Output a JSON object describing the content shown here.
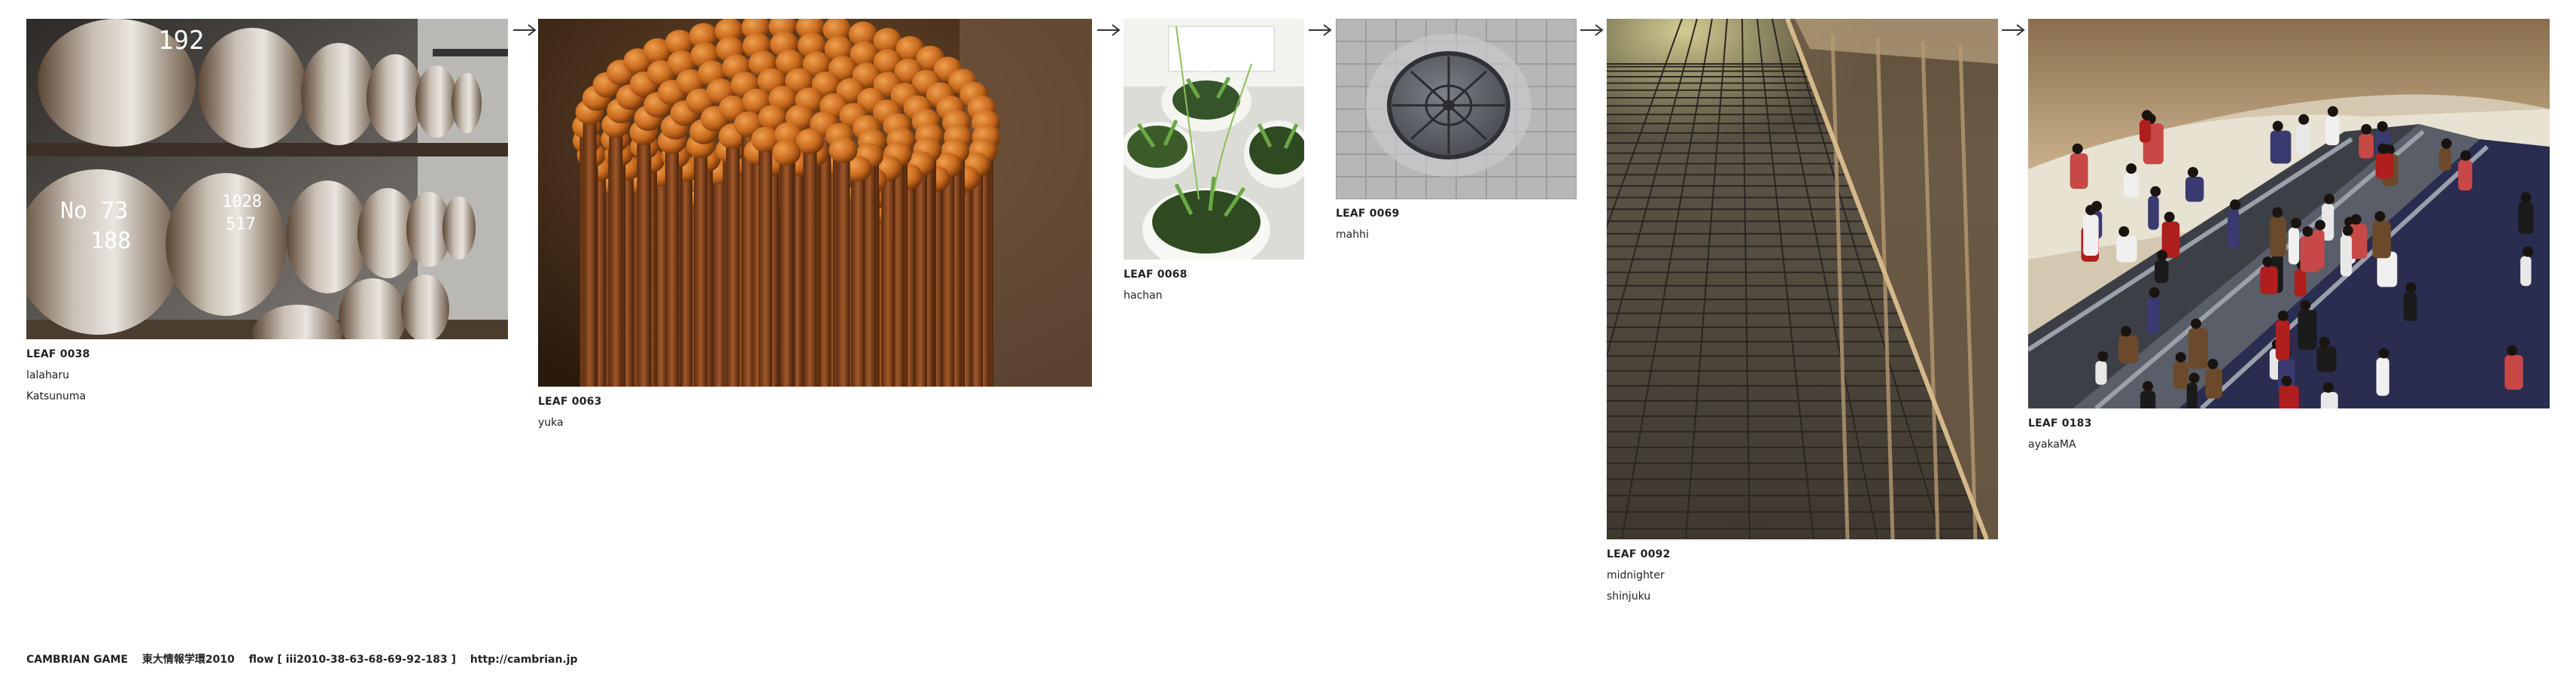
{
  "leaves": [
    {
      "id": "LEAF 0038",
      "lines": [
        "lalaharu",
        "Katsunuma"
      ],
      "subject": "whisky barrels in a warehouse"
    },
    {
      "id": "LEAF 0063",
      "lines": [
        "yuka"
      ],
      "subject": "bundle of matchsticks"
    },
    {
      "id": "LEAF 0068",
      "lines": [
        "hachan"
      ],
      "subject": "potted plants"
    },
    {
      "id": "LEAF 0069",
      "lines": [
        "mahhi"
      ],
      "subject": "manhole cover"
    },
    {
      "id": "LEAF 0092",
      "lines": [
        "midnighter",
        "shinjuku"
      ],
      "subject": "night walkway"
    },
    {
      "id": "LEAF 0183",
      "lines": [
        "ayakaMA"
      ],
      "subject": "escalators with crowd"
    }
  ],
  "barrel_markings": {
    "a": "192",
    "b": "No 73",
    "c": "188",
    "d": "1028",
    "e": "517"
  },
  "footer": {
    "brand": "CAMBRIAN GAME",
    "event": "東大情報学環2010",
    "flow": "flow [ iii2010-38-63-68-69-92-183 ]",
    "url": "http://cambrian.jp"
  },
  "icons": {
    "connector": "right-arrow-icon"
  }
}
